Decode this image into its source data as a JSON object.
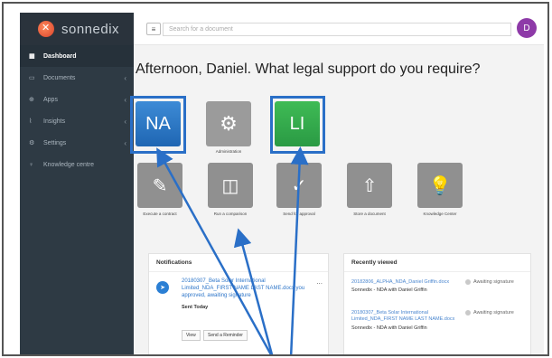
{
  "app": {
    "logo_text": "sonnedix"
  },
  "sidebar": {
    "items": [
      {
        "label": "Dashboard",
        "icon": "grid-icon",
        "active": true
      },
      {
        "label": "Documents",
        "icon": "document-icon"
      },
      {
        "label": "Apps",
        "icon": "apps-icon"
      },
      {
        "label": "Insights",
        "icon": "chart-icon"
      },
      {
        "label": "Settings",
        "icon": "gear-icon"
      },
      {
        "label": "Knowledge centre",
        "icon": "bulb-icon"
      }
    ]
  },
  "topbar": {
    "menu_icon": "≡",
    "search_placeholder": "Search for a document",
    "avatar_initial": "D"
  },
  "main": {
    "headline": "Afternoon, Daniel. What legal support do you require?",
    "tiles_row1": [
      {
        "text": "NA",
        "label": ""
      },
      {
        "text": "⚙",
        "label": "Administration"
      },
      {
        "text": "LI",
        "label": ""
      }
    ],
    "tiles_row2": [
      {
        "icon": "✎",
        "label": "Execute a contract"
      },
      {
        "icon": "◫",
        "label": "Run a comparison"
      },
      {
        "icon": "✓",
        "label": "Send for approval"
      },
      {
        "icon": "⇧",
        "label": "Store a document"
      },
      {
        "icon": "💡",
        "label": "Knowledge Center"
      }
    ]
  },
  "notifications": {
    "title": "Notifications",
    "item_text": "20180307_Beta Solar International Limited_NDA_FIRST NAME LAST NAME.docx you approved, awaiting signature",
    "item_time": "Sent Today",
    "more": "...",
    "view_label": "View",
    "reminder_label": "Send a Reminder"
  },
  "recently_viewed": {
    "title": "Recently viewed",
    "items": [
      {
        "link": "20182806_ALPHA_NDA_Daniel Griffin.docx",
        "sub": "Sonnedix - NDA with Daniel Griffin",
        "status": "Awaiting signature"
      },
      {
        "link": "20180307_Beta Solar International Limited_NDA_FIRST NAME LAST NAME.docx",
        "sub": "Sonnedix - NDA with Daniel Griffin",
        "status": "Awaiting signature"
      }
    ]
  },
  "colors": {
    "highlight": "#2a6fc7",
    "sidebar": "#2e3a44",
    "nda_tile": "#2a75c6",
    "li_tile": "#36ad4e",
    "avatar": "#8e3aa8"
  }
}
